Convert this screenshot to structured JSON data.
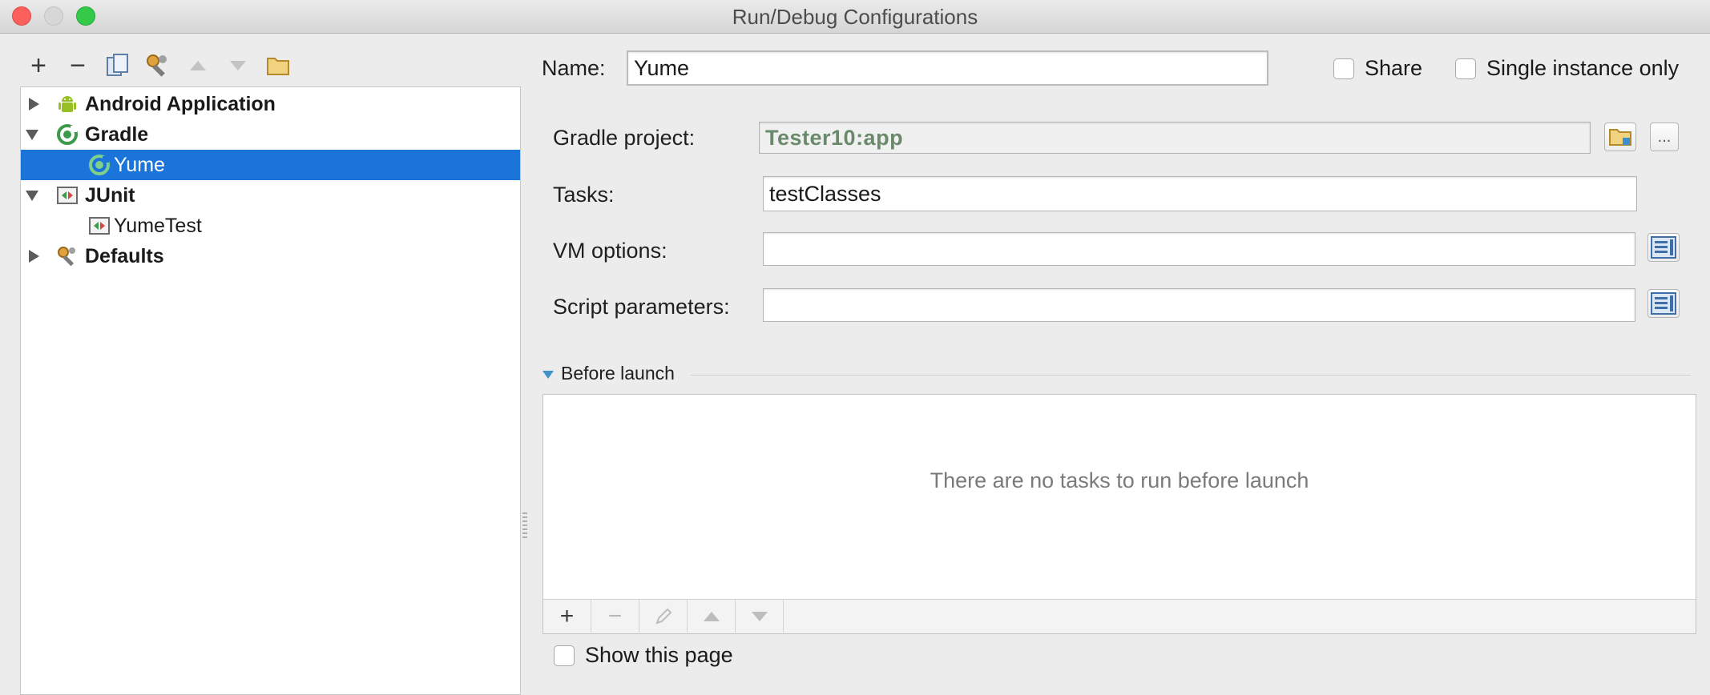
{
  "window": {
    "title": "Run/Debug Configurations"
  },
  "left_toolbar": {
    "add_icon": "+",
    "remove_icon": "−",
    "icons": [
      "add-icon",
      "remove-icon",
      "copy-icon",
      "edit-defaults-icon",
      "move-up-icon",
      "move-down-icon",
      "folder-icon"
    ]
  },
  "tree": {
    "items": [
      {
        "label": "Android Application",
        "expanded": false,
        "icon": "android-icon"
      },
      {
        "label": "Gradle",
        "expanded": true,
        "icon": "gradle-icon"
      },
      {
        "label": "Yume",
        "selected": true,
        "icon": "gradle-icon"
      },
      {
        "label": "JUnit",
        "expanded": true,
        "icon": "junit-icon"
      },
      {
        "label": "YumeTest",
        "icon": "junit-icon"
      },
      {
        "label": "Defaults",
        "expanded": false,
        "icon": "wrench-icon"
      }
    ]
  },
  "form": {
    "name_label": "Name:",
    "name_value": "Yume",
    "share_label": "Share",
    "single_instance_label": "Single instance only",
    "gradle_project_label": "Gradle project:",
    "gradle_project_value": "Tester10:app",
    "tasks_label": "Tasks:",
    "tasks_value": "testClasses",
    "vm_options_label": "VM options:",
    "vm_options_value": "",
    "script_params_label": "Script parameters:",
    "script_params_value": "",
    "browse_ellipsis": "..."
  },
  "before_launch": {
    "title": "Before launch",
    "empty_text": "There are no tasks to run before launch",
    "add_icon": "+",
    "remove_icon": "−"
  },
  "show_this_page_label": "Show this page",
  "colors": {
    "selection": "#1a74d9",
    "accent_triangle": "#3f93c8"
  }
}
